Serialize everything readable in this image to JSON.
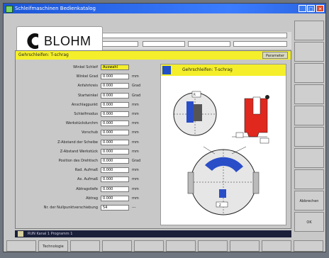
{
  "window": {
    "title": "Schleifmaschinen Bedienkatalog"
  },
  "logo": {
    "text": "BLOHM"
  },
  "panel": {
    "title": "Gehrschleifen: T-schrag",
    "tag": "Parameter",
    "selector_label": "Auswahl",
    "params": [
      {
        "label": "Winkel Schleif",
        "value": "Auswahl",
        "unit": ""
      },
      {
        "label": "Winkel Grad",
        "value": "0.000",
        "unit": "mm"
      },
      {
        "label": "Anfahrkreis",
        "value": "0.000",
        "unit": "Grad"
      },
      {
        "label": "Startwinkel",
        "value": "0.000",
        "unit": "Grad"
      },
      {
        "label": "Anschlagpunkt",
        "value": "0.000",
        "unit": "mm"
      },
      {
        "label": "Schleifmodus",
        "value": "0.000",
        "unit": "mm"
      },
      {
        "label": "Werkstückdurchm",
        "value": "0.000",
        "unit": "mm"
      },
      {
        "label": "Vorschub",
        "value": "0.000",
        "unit": "mm"
      },
      {
        "label": "Z-Abstand der Scheibe",
        "value": "0.000",
        "unit": "mm"
      },
      {
        "label": "Z-Abstand Werkstück",
        "value": "0.000",
        "unit": "mm"
      },
      {
        "label": "Position des Drehtisch",
        "value": "0.000",
        "unit": "Grad"
      },
      {
        "label": "Rad. Aufmaß",
        "value": "0.000",
        "unit": "mm"
      },
      {
        "label": "Ax. Aufmaß",
        "value": "0.000",
        "unit": "mm"
      },
      {
        "label": "Abtragstiefe",
        "value": "0.000",
        "unit": "mm"
      },
      {
        "label": "Abtrag",
        "value": "0.000",
        "unit": "mm"
      },
      {
        "label": "Nr. der Nullpunktverschiebung",
        "value": "54",
        "unit": "---"
      }
    ]
  },
  "diagram": {
    "title": "Gehrschleifen: T-schrag",
    "label_r": "R",
    "label_z": "Z"
  },
  "right_buttons": [
    "",
    "",
    "",
    "",
    "",
    "",
    "",
    "",
    "Abbrechen",
    "OK"
  ],
  "statusbar": {
    "text": "RUN   Kanal 1   Programm 1"
  },
  "bottom_buttons": [
    "",
    "Technologie",
    "",
    "",
    "",
    "",
    "",
    "",
    "",
    ""
  ]
}
